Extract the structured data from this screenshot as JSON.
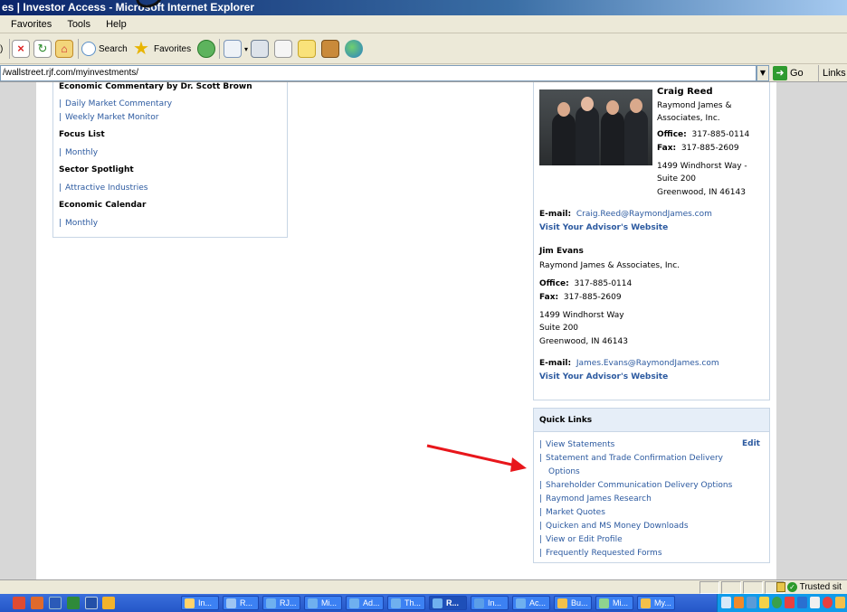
{
  "window": {
    "title": "es | Investor Access - Microsoft Internet Explorer"
  },
  "menu": [
    "Favorites",
    "Tools",
    "Help"
  ],
  "toolbar": {
    "search_label": "Search",
    "favorites_label": "Favorites"
  },
  "address": {
    "url": "/wallstreet.rjf.com/myinvestments/",
    "go_label": "Go",
    "links_label": "Links"
  },
  "research": {
    "heading_commentary": "Economic Commentary by Dr. Scott Brown",
    "commentary_links": [
      "Daily Market Commentary",
      "Weekly Market Monitor"
    ],
    "heading_focus": "Focus List",
    "focus_links": [
      "Monthly"
    ],
    "heading_sector": "Sector Spotlight",
    "sector_links": [
      "Attractive Industries"
    ],
    "heading_calendar": "Economic Calendar",
    "calendar_links": [
      "Monthly"
    ]
  },
  "advisor1": {
    "name": "Craig Reed",
    "firm_line1": "Raymond James &",
    "firm_line2": "Associates, Inc.",
    "office_label": "Office:",
    "office": "317-885-0114",
    "fax_label": "Fax:",
    "fax": "317-885-2609",
    "addr1": "1499 Windhorst Way -",
    "addr2": "Suite 200",
    "addr3": "Greenwood, IN 46143",
    "email_label": "E-mail:",
    "email": "Craig.Reed@RaymondJames.com",
    "website": "Visit Your Advisor's Website"
  },
  "advisor2": {
    "name": "Jim Evans",
    "firm": "Raymond James & Associates, Inc.",
    "office_label": "Office:",
    "office": "317-885-0114",
    "fax_label": "Fax:",
    "fax": "317-885-2609",
    "addr1": "1499 Windhorst Way",
    "addr2": "Suite 200",
    "addr3": "Greenwood, IN 46143",
    "email_label": "E-mail:",
    "email": "James.Evans@RaymondJames.com",
    "website": "Visit Your Advisor's Website"
  },
  "quicklinks": {
    "title": "Quick Links",
    "edit_label": "Edit",
    "items": [
      "View Statements",
      "Statement and Trade Confirmation Delivery",
      "Options",
      "Shareholder Communication Delivery Options",
      "Raymond James Research",
      "Market Quotes",
      "Quicken and MS Money Downloads",
      "View or Edit Profile",
      "Frequently Requested Forms"
    ]
  },
  "status": {
    "zone": "Trusted sit"
  },
  "taskbar": {
    "tasks": [
      "In...",
      "R...",
      "RJ...",
      "Mi...",
      "Ad...",
      "Th...",
      "R...",
      "In...",
      "Ac...",
      "Bu...",
      "Mi...",
      "My..."
    ]
  },
  "colors": {
    "link": "#2c5aa0",
    "arrow": "#e8161b",
    "titlebar": "#0a246a"
  }
}
